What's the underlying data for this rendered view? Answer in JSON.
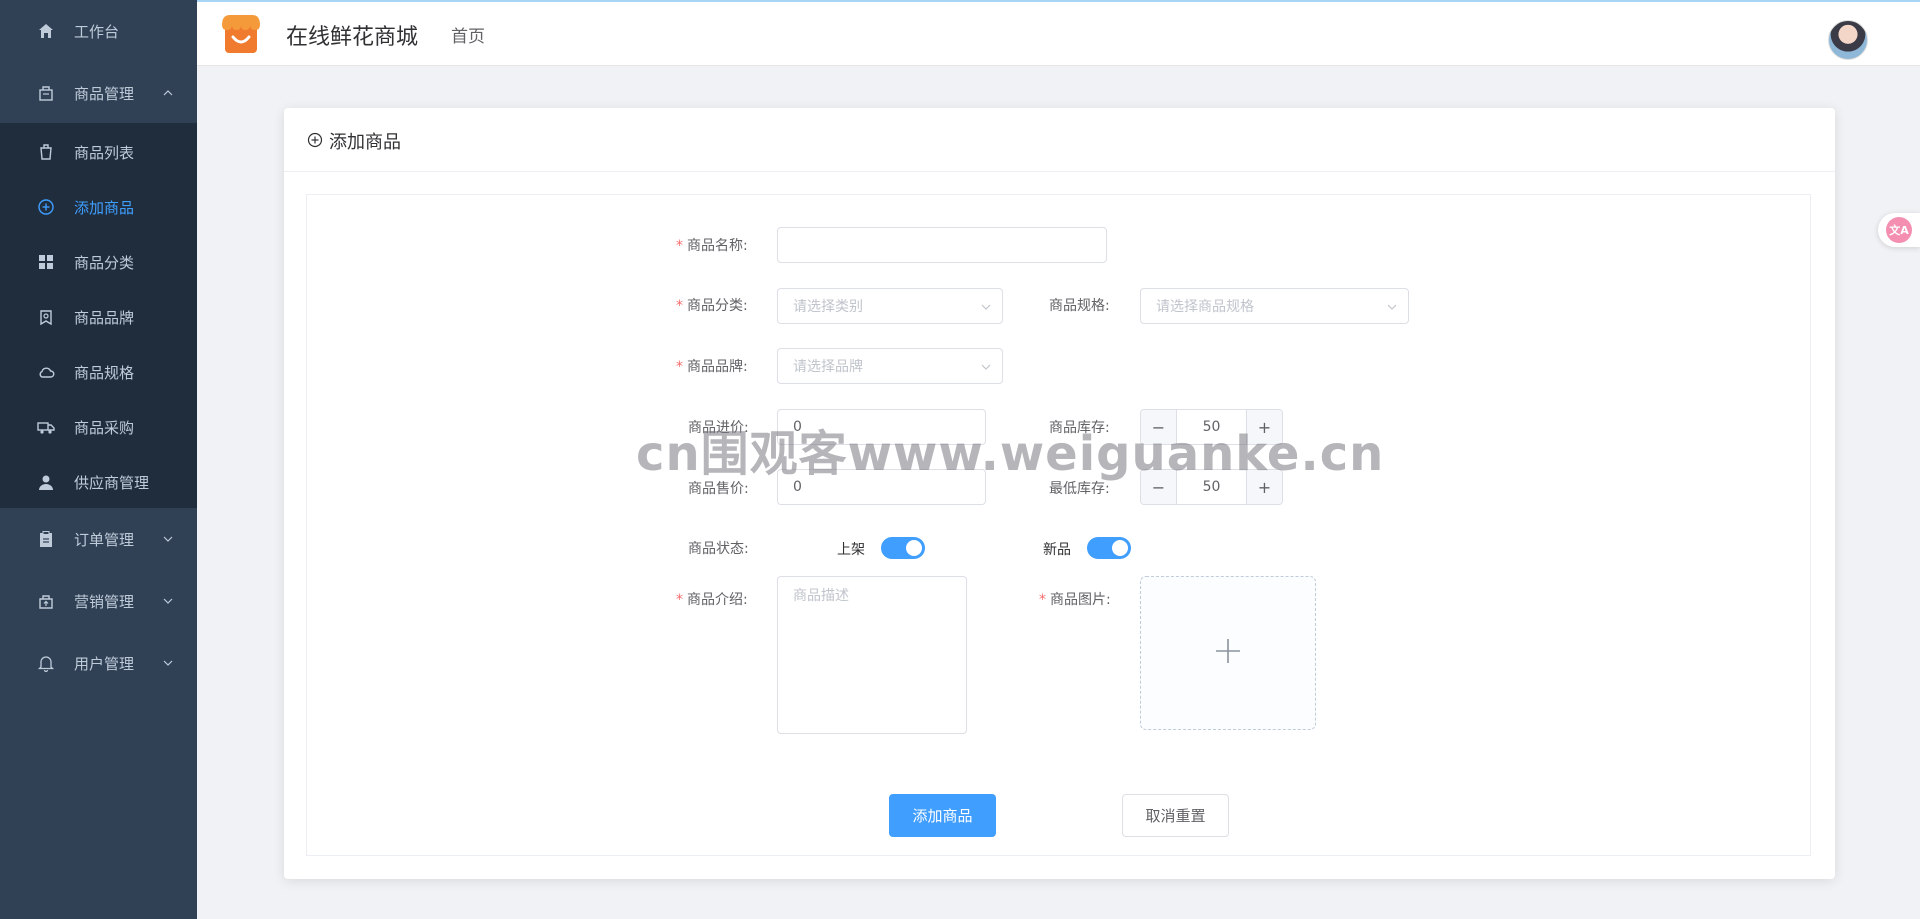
{
  "app": {
    "title": "在线鲜花商城",
    "breadcrumb": "首页"
  },
  "sidebar": {
    "items": [
      {
        "label": "工作台",
        "icon": "home-icon"
      },
      {
        "label": "商品管理",
        "icon": "bag-icon",
        "expanded": true
      },
      {
        "label": "商品列表",
        "icon": "trash-bag-icon"
      },
      {
        "label": "添加商品",
        "icon": "plus-circle-icon",
        "active": true
      },
      {
        "label": "商品分类",
        "icon": "grid-icon"
      },
      {
        "label": "商品品牌",
        "icon": "badge-icon"
      },
      {
        "label": "商品规格",
        "icon": "cloud-icon"
      },
      {
        "label": "商品采购",
        "icon": "truck-icon"
      },
      {
        "label": "供应商管理",
        "icon": "user-icon"
      },
      {
        "label": "订单管理",
        "icon": "clipboard-icon"
      },
      {
        "label": "营销管理",
        "icon": "marketing-icon"
      },
      {
        "label": "用户管理",
        "icon": "bell-icon"
      }
    ]
  },
  "card": {
    "title": "添加商品"
  },
  "form": {
    "name_label": "商品名称:",
    "name_value": "",
    "category_label": "商品分类:",
    "category_placeholder": "请选择类别",
    "spec_label": "商品规格:",
    "spec_placeholder": "请选择商品规格",
    "brand_label": "商品品牌:",
    "brand_placeholder": "请选择品牌",
    "purchase_price_label": "商品进价:",
    "purchase_price_value": "0",
    "stock_label": "商品库存:",
    "stock_value": "50",
    "sale_price_label": "商品售价:",
    "sale_price_value": "0",
    "min_stock_label": "最低库存:",
    "min_stock_value": "50",
    "status_label": "商品状态:",
    "on_shelf_label": "上架",
    "on_shelf": true,
    "new_label": "新品",
    "is_new": true,
    "desc_label": "商品介绍:",
    "desc_placeholder": "商品描述",
    "image_label": "商品图片:",
    "submit_label": "添加商品",
    "reset_label": "取消重置"
  },
  "float_button": {
    "text": "文A"
  },
  "watermark": "cn围观客www.weiguanke.cn",
  "colors": {
    "sidebar": "#304156",
    "submenu": "#1f2d3d",
    "primary": "#409eff",
    "required": "#f56c6c"
  }
}
